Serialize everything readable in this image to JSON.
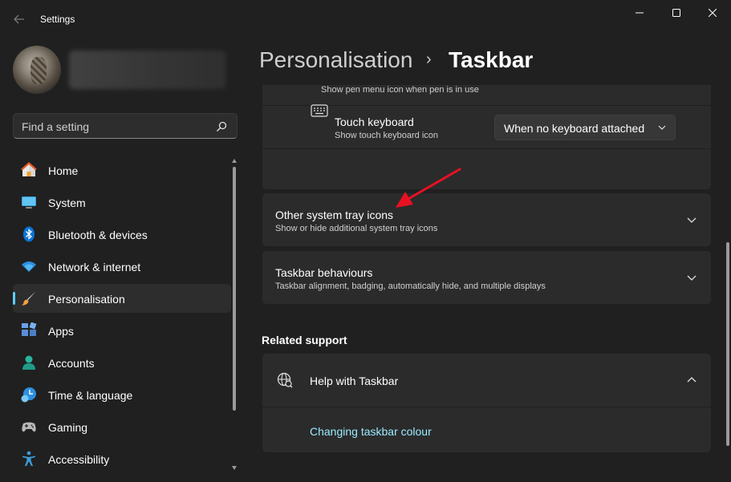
{
  "window": {
    "title": "Settings",
    "back_icon": "back-arrow-icon",
    "controls": [
      "minimize-icon",
      "maximize-icon",
      "close-icon"
    ]
  },
  "search": {
    "placeholder": "Find a setting",
    "icon": "search-icon"
  },
  "nav": {
    "items": [
      {
        "label": "Home",
        "icon": "home-icon",
        "selected": false
      },
      {
        "label": "System",
        "icon": "system-icon",
        "selected": false
      },
      {
        "label": "Bluetooth & devices",
        "icon": "bluetooth-icon",
        "selected": false
      },
      {
        "label": "Network & internet",
        "icon": "wifi-icon",
        "selected": false
      },
      {
        "label": "Personalisation",
        "icon": "brush-icon",
        "selected": true
      },
      {
        "label": "Apps",
        "icon": "apps-icon",
        "selected": false
      },
      {
        "label": "Accounts",
        "icon": "accounts-icon",
        "selected": false
      },
      {
        "label": "Time & language",
        "icon": "time-language-icon",
        "selected": false
      },
      {
        "label": "Gaming",
        "icon": "gamepad-icon",
        "selected": false
      },
      {
        "label": "Accessibility",
        "icon": "accessibility-icon",
        "selected": false
      }
    ]
  },
  "breadcrumb": {
    "parent": "Personalisation",
    "separator": "›",
    "current": "Taskbar"
  },
  "content": {
    "pen_menu": {
      "subtitle": "Show pen menu icon when pen is in use",
      "state": "Off"
    },
    "touch_keyboard": {
      "title": "Touch keyboard",
      "subtitle": "Show touch keyboard icon",
      "dropdown_value": "When no keyboard attached"
    },
    "other_tray": {
      "title": "Other system tray icons",
      "subtitle": "Show or hide additional system tray icons"
    },
    "behaviours": {
      "title": "Taskbar behaviours",
      "subtitle": "Taskbar alignment, badging, automatically hide, and multiple displays"
    },
    "related_support": {
      "heading": "Related support",
      "help_title": "Help with Taskbar",
      "link": "Changing taskbar colour"
    }
  },
  "colors": {
    "accent": "#60cdff",
    "link": "#99ebff",
    "annotation": "#e81123",
    "background": "#202020",
    "card": "#2b2b2b"
  }
}
